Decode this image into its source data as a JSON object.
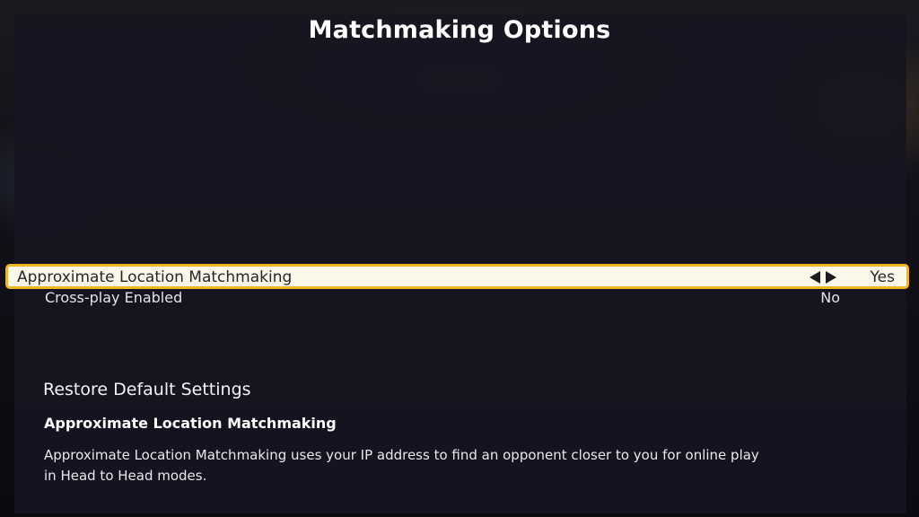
{
  "screen": {
    "title": "Matchmaking Options"
  },
  "options": [
    {
      "label": "Approximate Location Matchmaking",
      "value": "Yes",
      "selected": true
    },
    {
      "label": "Cross-play Enabled",
      "value": "No",
      "selected": false
    }
  ],
  "restore_label": "Restore Default Settings",
  "description": {
    "title": "Approximate Location Matchmaking",
    "body": "Approximate Location Matchmaking uses your IP address to find an opponent closer to you for online play in Head to Head modes."
  },
  "colors": {
    "highlight_border": "#f2b623",
    "highlight_fill": "#fbf8ea",
    "panel": "#161521"
  },
  "icons": {
    "selector_left": "triangle-left-icon",
    "selector_right": "triangle-right-icon"
  }
}
